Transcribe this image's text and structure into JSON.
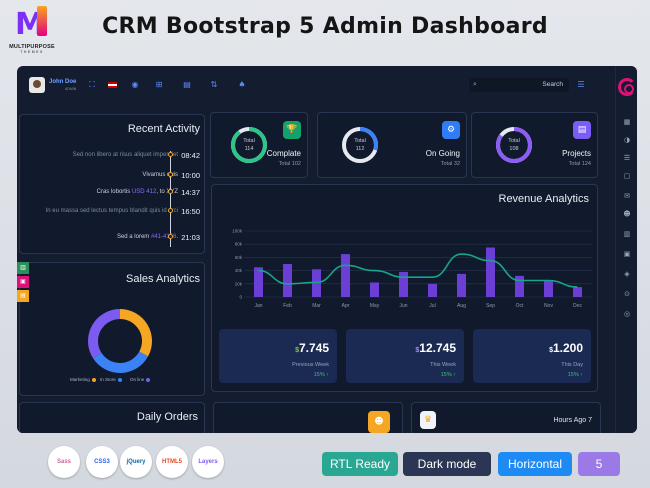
{
  "branding": {
    "line1": "MULTIPURPOSE",
    "line2": "THEMES"
  },
  "headline": "CRM Bootstrap 5 Admin Dashboard",
  "user": {
    "name": "John Doe",
    "role": "ADMIN"
  },
  "search": {
    "placeholder": "Search"
  },
  "recent_activity": {
    "title": "Recent Activity",
    "items": [
      {
        "text": "Sed non libero at risus aliquet imperdiet",
        "time": "08:42",
        "muted": true
      },
      {
        "text": "Vivamus quis",
        "time": "10:00",
        "muted": false
      },
      {
        "text_pre": "Cras lobortis ",
        "highlight": "USD 412",
        "text_post": ", to XYZ",
        "time": "14:37",
        "muted": false
      },
      {
        "text": "In eu massa sed lectus tempus blandit quis id orci",
        "time": "16:50",
        "muted": true
      },
      {
        "text_pre": "Sed a lorem ",
        "highlight": "#41-4156",
        "text_post": ".",
        "time": "21:03",
        "muted": false
      }
    ]
  },
  "stats": [
    {
      "ring_label": "Total",
      "ring_value": "114",
      "name": "Complate",
      "total": "Total 102",
      "color": "#2ec58a",
      "progress": 0.9,
      "icon": "trophy-icon",
      "icon_glyph": "🏆",
      "icon_bg": "#11a36b"
    },
    {
      "ring_label": "Total",
      "ring_value": "112",
      "name": "On Going",
      "total": "Total 32",
      "color": "#3b82f6",
      "progress": 0.3,
      "icon": "share-icon",
      "icon_glyph": "⚙",
      "icon_bg": "#2f7df6"
    },
    {
      "ring_label": "Total",
      "ring_value": "108",
      "name": "Projects",
      "total": "Total 124",
      "color": "#8b5cf6",
      "progress": 0.85,
      "icon": "document-icon",
      "icon_glyph": "▤",
      "icon_bg": "#7b5cf6"
    }
  ],
  "revenue": {
    "title": "Revenue Analytics",
    "cards": [
      {
        "currency": "$",
        "value": "7.745",
        "label": "Previous Week",
        "pct": "15% ↑",
        "style": "g"
      },
      {
        "currency": "$",
        "value": "12.745",
        "label": "This Week",
        "pct": "15% ↑",
        "style": "p"
      },
      {
        "currency": "$",
        "value": "1.200",
        "label": "This Day",
        "pct": "15% ↑",
        "style": "w"
      }
    ]
  },
  "chart_data": {
    "type": "bar",
    "categories": [
      "Jan",
      "Feb",
      "Mar",
      "Apr",
      "May",
      "Jun",
      "Jul",
      "Aug",
      "Sep",
      "Oct",
      "Nov",
      "Dec"
    ],
    "series": [
      {
        "values": [
          45,
          50,
          42,
          65,
          22,
          38,
          20,
          35,
          75,
          32,
          25,
          15
        ]
      },
      {
        "values": [
          40,
          20,
          22,
          48,
          40,
          30,
          30,
          65,
          55,
          25,
          25,
          15
        ]
      }
    ],
    "y_ticks": [
      "100k",
      "80k",
      "60k",
      "40k",
      "20k",
      "0"
    ],
    "ylim": [
      0,
      100
    ],
    "colors": {
      "bars": "#6b3fd6",
      "line": "#17a58a"
    }
  },
  "sales": {
    "title": "Sales Analytics",
    "legend": [
      {
        "label": "Marketing",
        "color": "#f5a623"
      },
      {
        "label": "In Store",
        "color": "#3b82f6"
      },
      {
        "label": "On line",
        "color": "#7c5cf0"
      }
    ],
    "values": [
      33,
      33,
      34
    ]
  },
  "daily_orders": {
    "title": "Daily Orders"
  },
  "hours_ago": "Hours Ago 7",
  "tech": [
    "Sass",
    "CSS3",
    "jQuery",
    "HTML5",
    "Layers"
  ],
  "badges": [
    {
      "label": "RTL Ready",
      "color": "#2aa792"
    },
    {
      "label": "Dark mode",
      "color": "#2b3554"
    },
    {
      "label": "Horizontal",
      "color": "#1e8bf5"
    },
    {
      "label": "5",
      "color": "#9b7ae8"
    }
  ]
}
